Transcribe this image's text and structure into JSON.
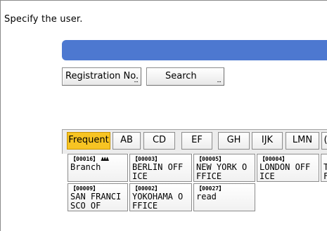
{
  "prompt": "Specify the user.",
  "buttons": {
    "registration_no": "Registration No.",
    "search": "Search",
    "ellipsis": "..."
  },
  "tabs": [
    {
      "label": "Frequent",
      "active": true
    },
    {
      "label": "AB",
      "active": false
    },
    {
      "label": "CD",
      "active": false
    },
    {
      "label": "EF",
      "active": false
    },
    {
      "label": "GH",
      "active": false
    },
    {
      "label": "IJK",
      "active": false
    },
    {
      "label": "LMN",
      "active": false
    },
    {
      "label": "(",
      "active": false
    }
  ],
  "entries": [
    {
      "code": "【00016】",
      "name": "Branch",
      "group_icon": "group-icon"
    },
    {
      "code": "【00003】",
      "name": "BERLIN OFF\nICE"
    },
    {
      "code": "【00005】",
      "name": "NEW YORK O\nFFICE"
    },
    {
      "code": "【00004】",
      "name": "LONDON OFF\nICE"
    },
    {
      "code": "【",
      "name": "T\nF"
    },
    {
      "code": "【00009】",
      "name": "SAN FRANCI\nSCO OF"
    },
    {
      "code": "【00002】",
      "name": "YOKOHAMA O\nFFICE"
    },
    {
      "code": "【00027】",
      "name": "read"
    }
  ],
  "colors": {
    "header_bar": "#4d78d0",
    "active_tab": "#f7c423"
  }
}
